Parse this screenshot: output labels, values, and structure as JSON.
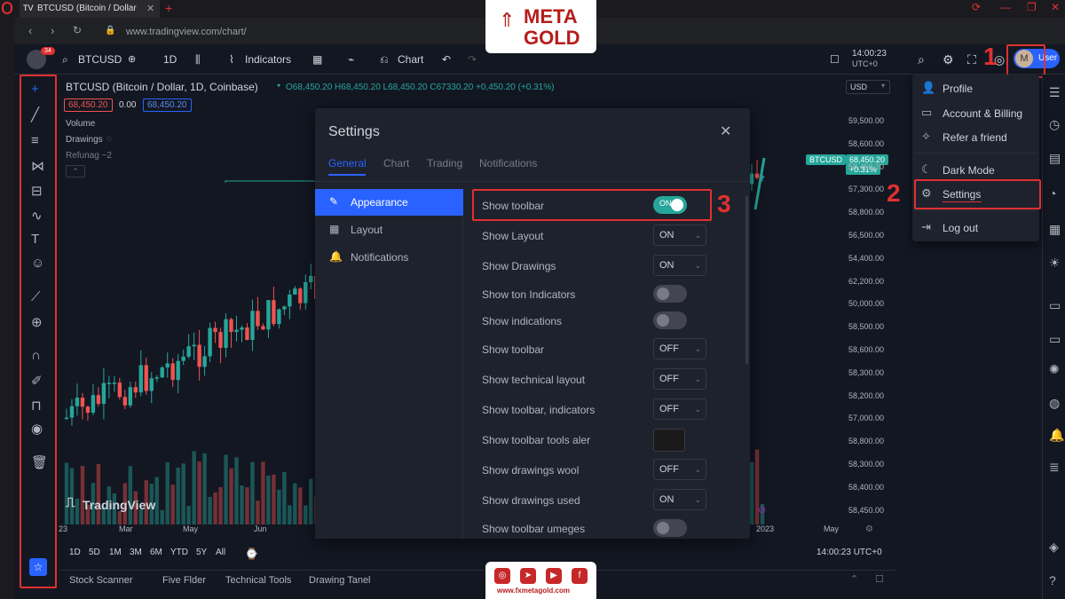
{
  "browser": {
    "tab_title": "BTCUSD (Bitcoin / Dollar",
    "url": "www.tradingview.com/chart/"
  },
  "toolbar": {
    "avatar_badge": "34",
    "symbol": "BTCUSD",
    "interval": "1D",
    "indicators_label": "Indicators",
    "chart_label": "Chart",
    "clock": "14:00:23",
    "timezone": "UTC+0",
    "user_label": "User",
    "user_initial": "M"
  },
  "chart": {
    "title": "BTCUSD (Bitcoin / Dollar, 1D, Coinbase)",
    "ohlc": "O68,450.20  H68,450.20  L68,450.20  C67330.20  +0,450.20 (+0.31%)",
    "bid": "68,450.20",
    "spread": "0.00",
    "ask": "68,450.20",
    "volume_label": "Volume",
    "drawings_label": "Drawings",
    "refunag_label": "Refunag ~2",
    "currency": "USD",
    "last_symbol": "BTCUSD",
    "last_price": "68,450.20",
    "last_change": "+0.31%",
    "watermark": "TradingView",
    "y_ticks": [
      "59,500.00",
      "58,600.00",
      "58,450.20",
      "57,300.00",
      "58,800.00",
      "56,500.00",
      "54,400.00",
      "62,200.00",
      "50,000.00",
      "58,500.00",
      "58,600.00",
      "58,300.00",
      "58,200.00",
      "57,000.00",
      "58,800.00",
      "58,300.00",
      "58,400.00",
      "58,450.00"
    ],
    "x_ticks": [
      "23",
      "Mar",
      "May",
      "Jun",
      "2023",
      "May"
    ],
    "time_ranges": [
      "1D",
      "5D",
      "1M",
      "3M",
      "6M",
      "YTD",
      "5Y",
      "All"
    ],
    "bottom_clock": "14:00:23 UTC+0"
  },
  "bottom_tabs": [
    "Stock Scanner",
    "Five Flder",
    "Technical Tools",
    "Drawing Tanel"
  ],
  "settings": {
    "title": "Settings",
    "tabs": [
      "General",
      "Chart",
      "Trading",
      "Notifications"
    ],
    "sidebar": [
      "Appearance",
      "Layout",
      "Notifications"
    ],
    "rows": [
      {
        "label": "Show toolbar",
        "type": "toggle",
        "on": true,
        "value": "ON"
      },
      {
        "label": "Show Layout",
        "type": "select",
        "value": "ON"
      },
      {
        "label": "Show Drawings",
        "type": "select",
        "value": "ON"
      },
      {
        "label": "Show ton Indicators",
        "type": "toggle",
        "on": false,
        "value": ""
      },
      {
        "label": "Show indications",
        "type": "toggle",
        "on": false,
        "value": ""
      },
      {
        "label": "Show toolbar",
        "type": "select",
        "value": "OFF"
      },
      {
        "label": "Show technical layout",
        "type": "select",
        "value": "OFF"
      },
      {
        "label": "Show toolbar, indicators",
        "type": "select",
        "value": "OFF"
      },
      {
        "label": "Show toolbar tools aler",
        "type": "box",
        "value": ""
      },
      {
        "label": "Show drawings wool",
        "type": "select",
        "value": "OFF"
      },
      {
        "label": "Show drawings used",
        "type": "select",
        "value": "ON"
      },
      {
        "label": "Show toolbar umeges",
        "type": "toggle",
        "on": false,
        "value": ""
      }
    ]
  },
  "user_menu": {
    "items": [
      "Profile",
      "Account & Billing",
      "Refer a friend",
      "Dark Mode",
      "Settings",
      "Log out"
    ]
  },
  "annotations": {
    "step1": "1",
    "step2": "2",
    "step3": "3"
  },
  "brand": {
    "line1": "META",
    "line2": "GOLD",
    "site": "www.fxmetagold.com"
  },
  "colors": {
    "up": "#26a69a",
    "down": "#ef5350",
    "accent": "#2962ff",
    "highlight": "#e03030"
  }
}
